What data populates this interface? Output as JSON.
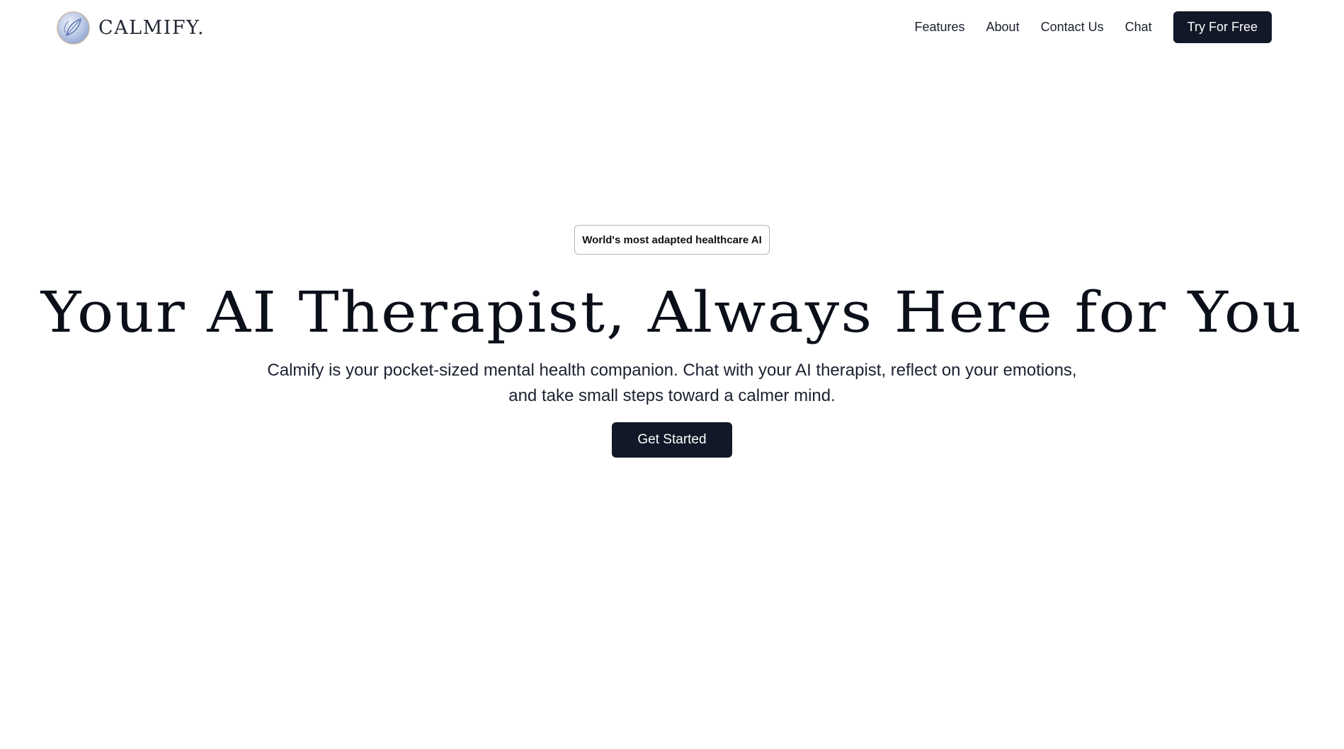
{
  "header": {
    "brand_name": "CALMIFY.",
    "logo_icon": "leaf-logo-icon",
    "nav": [
      {
        "label": "Features"
      },
      {
        "label": "About"
      },
      {
        "label": "Contact Us"
      },
      {
        "label": "Chat"
      }
    ],
    "cta_label": "Try For Free"
  },
  "hero": {
    "badge": "World's most adapted healthcare AI",
    "title": "Your AI Therapist, Always Here for You",
    "subtitle_line1": "Calmify is your pocket-sized mental health companion. Chat with your AI therapist, reflect on your emotions,",
    "subtitle_line2": "and take small steps toward a calmer mind.",
    "cta_label": "Get Started"
  },
  "colors": {
    "primary_dark": "#111827",
    "background": "#ffffff",
    "text": "#0b1220"
  }
}
